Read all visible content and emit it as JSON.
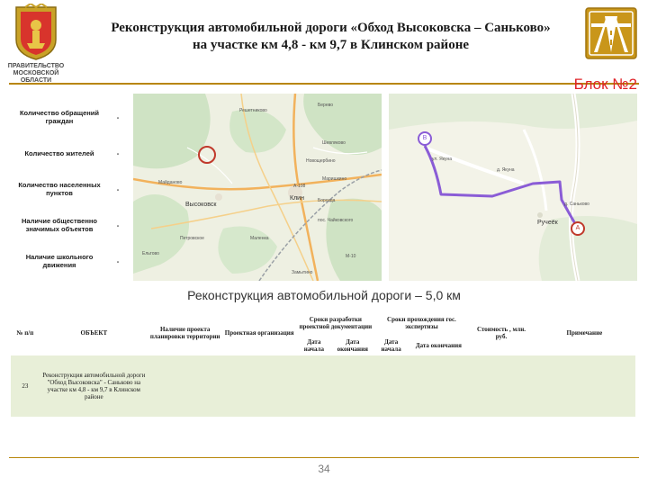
{
  "header": {
    "title_line1": "Реконструкция автомобильной дороги «Обход Высоковска – Саньково»",
    "title_line2": "на участке км 4,8 - км 9,7 в Клинском районе",
    "gov_line1": "ПРАВИТЕЛЬСТВО",
    "gov_line2": "МОСКОВСКОЙ",
    "gov_line3": "ОБЛАСТИ"
  },
  "block_label": "Блок №2",
  "stats": [
    {
      "label": "Количество обращений граждан",
      "value": "-"
    },
    {
      "label": "Количество жителей",
      "value": "-"
    },
    {
      "label": "Количество населенных пунктов",
      "value": "-"
    },
    {
      "label": "Наличие общественно значимых объектов",
      "value": "-"
    },
    {
      "label": "Наличие школьного движения",
      "value": "-"
    }
  ],
  "map1": {
    "labels": {
      "reshetnikovo": "Решетниково",
      "berevo": "Берево",
      "shevlyakovo": "Шевляково",
      "novoshcherbino": "Новощербино",
      "vysokovsk": "Высоковск",
      "klin": "Клин",
      "borozda": "Борозда",
      "chaikovsky": "пос. Чайковского",
      "petrovskoe": "Петровское",
      "maydanovo": "Майданово",
      "marishkino": "Маришкино",
      "zamytino": "Замытино",
      "eltsovo": "Ельтово",
      "malenka": "Маленка",
      "road_a108": "А-108",
      "road_m10": "М-10"
    }
  },
  "map2": {
    "labels": {
      "street1": "ул. Якуна",
      "street2": "д. Якуна",
      "street3": "д. Саньково",
      "rucheyok": "Ручеёк",
      "marker_a": "A",
      "marker_b": "B"
    }
  },
  "subtitle": "Реконструкция автомобильной дороги – 5,0 км",
  "table": {
    "headers": {
      "num": "№ п/п",
      "object": "ОБЪЕКТ",
      "plan": "Наличие проекта планировки территории",
      "org": "Проектная организация",
      "design_dates": "Сроки разработки проектной документации",
      "expert_dates": "Сроки прохождения гос. экспертизы",
      "cost": "Стоимость , млн. руб.",
      "note": "Примечание",
      "start1": "Дата начала",
      "end1": "Дата окончания",
      "start2": "Дата начала",
      "end2": "Дата окончания"
    },
    "rows": [
      {
        "num": "23",
        "object": "Реконструкция автомобильной дороги \"Обход Высоковска\" - Саньково на участке км 4,8 - км 9,7 в Клинском районе",
        "plan": "",
        "org": "",
        "start1": "",
        "end1": "",
        "start2": "",
        "end2": "",
        "cost": "",
        "note": ""
      }
    ]
  },
  "page_number": "34",
  "colors": {
    "accent_gold": "#b8860b",
    "block_red": "#e0242a",
    "row_green": "#e8efd8",
    "route_purple": "#8a5cd6",
    "marker_red": "#c0392b"
  }
}
